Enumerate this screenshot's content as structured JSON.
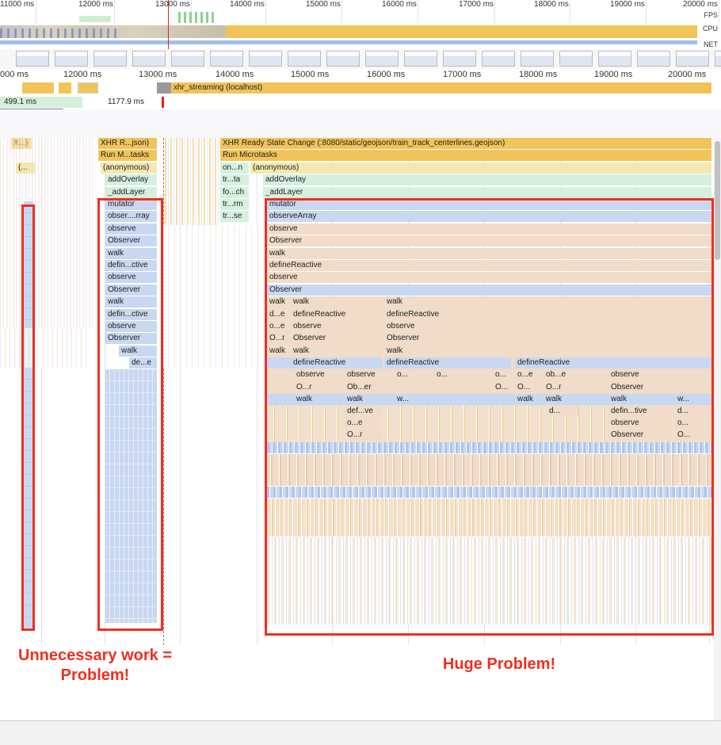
{
  "overview": {
    "ticks": [
      {
        "label": "11000 ms"
      },
      {
        "label": "12000 ms"
      },
      {
        "label": "13000 ms"
      },
      {
        "label": "14000 ms"
      },
      {
        "label": "15000 ms"
      },
      {
        "label": "16000 ms"
      },
      {
        "label": "17000 ms"
      },
      {
        "label": "18000 ms"
      },
      {
        "label": "19000 ms"
      },
      {
        "label": "20000 ms"
      }
    ],
    "lanes": {
      "fps": "FPS",
      "cpu": "CPU",
      "net": "NET"
    }
  },
  "ruler": {
    "ticks": [
      {
        "label": "000 ms"
      },
      {
        "label": "12000 ms"
      },
      {
        "label": "13000 ms"
      },
      {
        "label": "14000 ms"
      },
      {
        "label": "15000 ms"
      },
      {
        "label": "16000 ms"
      },
      {
        "label": "17000 ms"
      },
      {
        "label": "18000 ms"
      },
      {
        "label": "19000 ms"
      },
      {
        "label": "20000 ms"
      }
    ]
  },
  "network": {
    "request": "xhr_streaming (localhost)"
  },
  "frames": {
    "first": "499.1 ms",
    "second": "1177.9 ms"
  },
  "flame": {
    "left_column": [
      "X...)",
      "(...",
      "(anonymous)"
    ],
    "mid_column": [
      "XHR R...json)",
      "Run M...tasks",
      "(anonymous)",
      "addOverlay",
      "_addLayer",
      "mutator",
      "obser....rray",
      "observe",
      "Observer",
      "walk",
      "defin...ctive",
      "observe",
      "Observer",
      "walk",
      "defin...ctive",
      "observe",
      "Observer",
      "walk",
      "de...e"
    ],
    "narrow_column": [
      "on...n",
      "tr...ta",
      "fo...ch",
      "tr...rm",
      "tr...se"
    ],
    "main_header": "XHR Ready State Change (:8080/static/geojson/train_track_centerlines.geojson)",
    "run_microtasks": "Run Microtasks",
    "anonymous": "(anonymous)",
    "addOverlay": "addOverlay",
    "addLayer": "_addLayer",
    "main_column": [
      "mutator",
      "observeArray",
      "observe",
      "Observer",
      "walk",
      "defineReactive",
      "observe",
      "Observer"
    ],
    "rows": {
      "walk_row": [
        "walk",
        "walk",
        "walk"
      ],
      "define_row": [
        "d...e",
        "defineReactive",
        "defineReactive"
      ],
      "observe_row": [
        "o...e",
        "observe",
        "observe"
      ],
      "observer_row": [
        "O...r",
        "Observer",
        "Observer"
      ],
      "walk_row2": [
        "walk",
        "walk",
        "walk"
      ],
      "define_row2": [
        "defineReactive",
        "defineReactive",
        "defineReactive"
      ],
      "observe_row2": [
        "observe",
        "observe",
        "o...",
        "o...",
        "o...",
        "o...e",
        "ob...e",
        "observe"
      ],
      "observer_row2": [
        "O...r",
        "Ob...er",
        "O...",
        "O...",
        "O...r",
        "Observer"
      ],
      "walk_row3": [
        "walk",
        "walk",
        "w...",
        "walk",
        "walk",
        "walk",
        "w..."
      ],
      "define_row3": [
        "def...ve",
        "d...",
        "defin...tive",
        "d..."
      ],
      "observe_row3": [
        "o...e",
        "observe",
        "o..."
      ],
      "observer_row3": [
        "O...r",
        "Observer",
        "O..."
      ]
    }
  },
  "annotations": {
    "left_line1": "Unnecessary work =",
    "left_line2": "Problem!",
    "right": "Huge Problem!"
  },
  "colors": {
    "cpu_yellow": "#f0c457",
    "highlight_red": "#f22e1f",
    "flame_blue": "#c9d8f1",
    "flame_tan": "#f0dcc8",
    "flame_green": "#d5f0df",
    "flame_gold": "#f1c45a"
  }
}
